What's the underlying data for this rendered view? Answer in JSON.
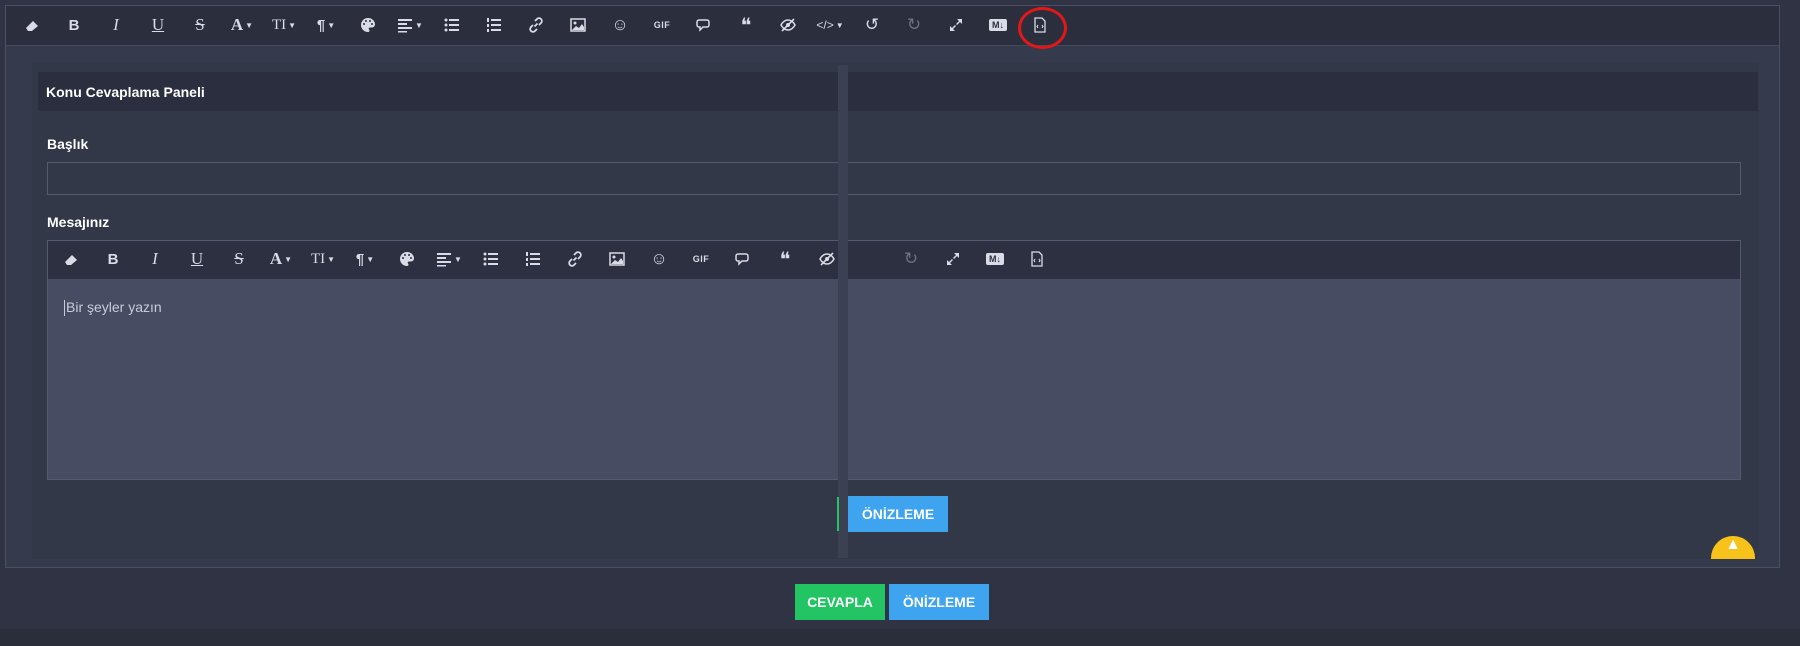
{
  "toolbar": {
    "items": [
      {
        "name": "eraser-icon"
      },
      {
        "name": "bold-icon",
        "text": "B"
      },
      {
        "name": "italic-icon",
        "text": "I"
      },
      {
        "name": "underline-icon",
        "text": "U"
      },
      {
        "name": "strikethrough-icon",
        "text": "S"
      },
      {
        "name": "font-color-icon",
        "text": "A"
      },
      {
        "name": "font-size-icon",
        "text": "TI"
      },
      {
        "name": "paragraph-icon",
        "text": "¶"
      },
      {
        "name": "palette-icon"
      },
      {
        "name": "align-icon"
      },
      {
        "name": "bullet-list-icon"
      },
      {
        "name": "numbered-list-icon"
      },
      {
        "name": "link-icon"
      },
      {
        "name": "image-icon"
      },
      {
        "name": "emoji-icon",
        "text": "☺"
      },
      {
        "name": "gif-icon",
        "text": "GIF"
      },
      {
        "name": "comment-icon"
      },
      {
        "name": "quote-icon",
        "text": "❝"
      },
      {
        "name": "hide-icon"
      },
      {
        "name": "code-icon",
        "text": "</>"
      },
      {
        "name": "undo-icon",
        "text": "↺"
      },
      {
        "name": "redo-icon",
        "text": "↻"
      },
      {
        "name": "fullscreen-icon"
      },
      {
        "name": "markdown-icon",
        "text": "M↓"
      },
      {
        "name": "source-file-icon"
      }
    ]
  },
  "panel": {
    "title": "Konu Cevaplama Paneli",
    "title_label": "Başlık",
    "message_label": "Mesajınız",
    "editor_placeholder": "Bir şeyler yazın",
    "preview_button": "ÖNİZLEME"
  },
  "footer": {
    "reply_button": "CEVAPLA",
    "preview_button": "ÖNİZLEME"
  },
  "colors": {
    "accent_blue": "#3fa4ef",
    "accent_green": "#23c464",
    "highlight_red": "#e01818",
    "fab_yellow": "#f7c21a"
  }
}
